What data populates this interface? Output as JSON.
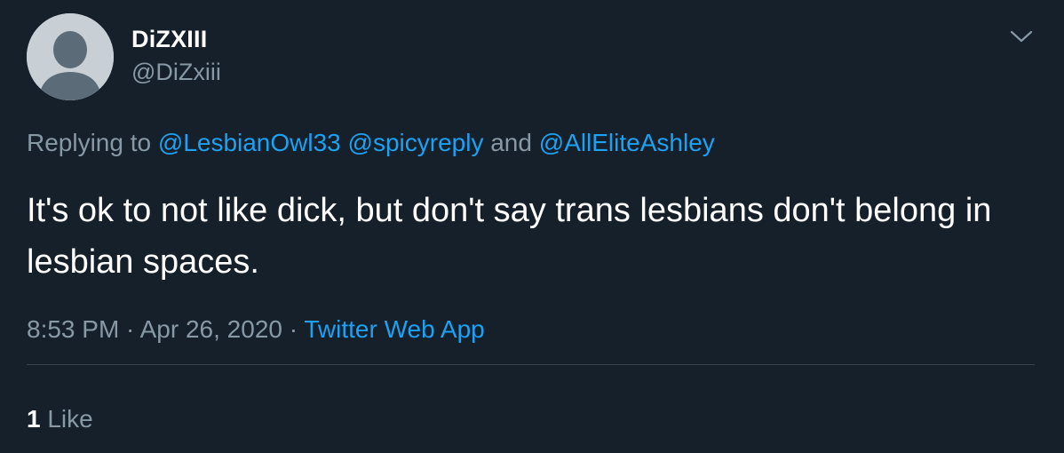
{
  "author": {
    "display_name": "DiZXIII",
    "handle": "@DiZxiii"
  },
  "reply_context": {
    "prefix": "Replying to ",
    "mentions": [
      "@LesbianOwl33",
      "@spicyreply",
      "@AllEliteAshley"
    ],
    "conjunction": " and "
  },
  "tweet": {
    "text": "It's ok to not like dick, but don't say trans lesbians don't belong in lesbian spaces."
  },
  "meta": {
    "time": "8:53 PM",
    "separator": " · ",
    "date": "Apr 26, 2020",
    "source": "Twitter Web App"
  },
  "stats": {
    "like_count": "1",
    "like_label": " Like"
  },
  "icons": {
    "avatar": "default-profile-icon",
    "more": "chevron-down-icon"
  },
  "colors": {
    "background": "#15202b",
    "primary_text": "#ffffff",
    "secondary_text": "#8899a6",
    "accent": "#1da1f2",
    "divider": "#38444d"
  }
}
